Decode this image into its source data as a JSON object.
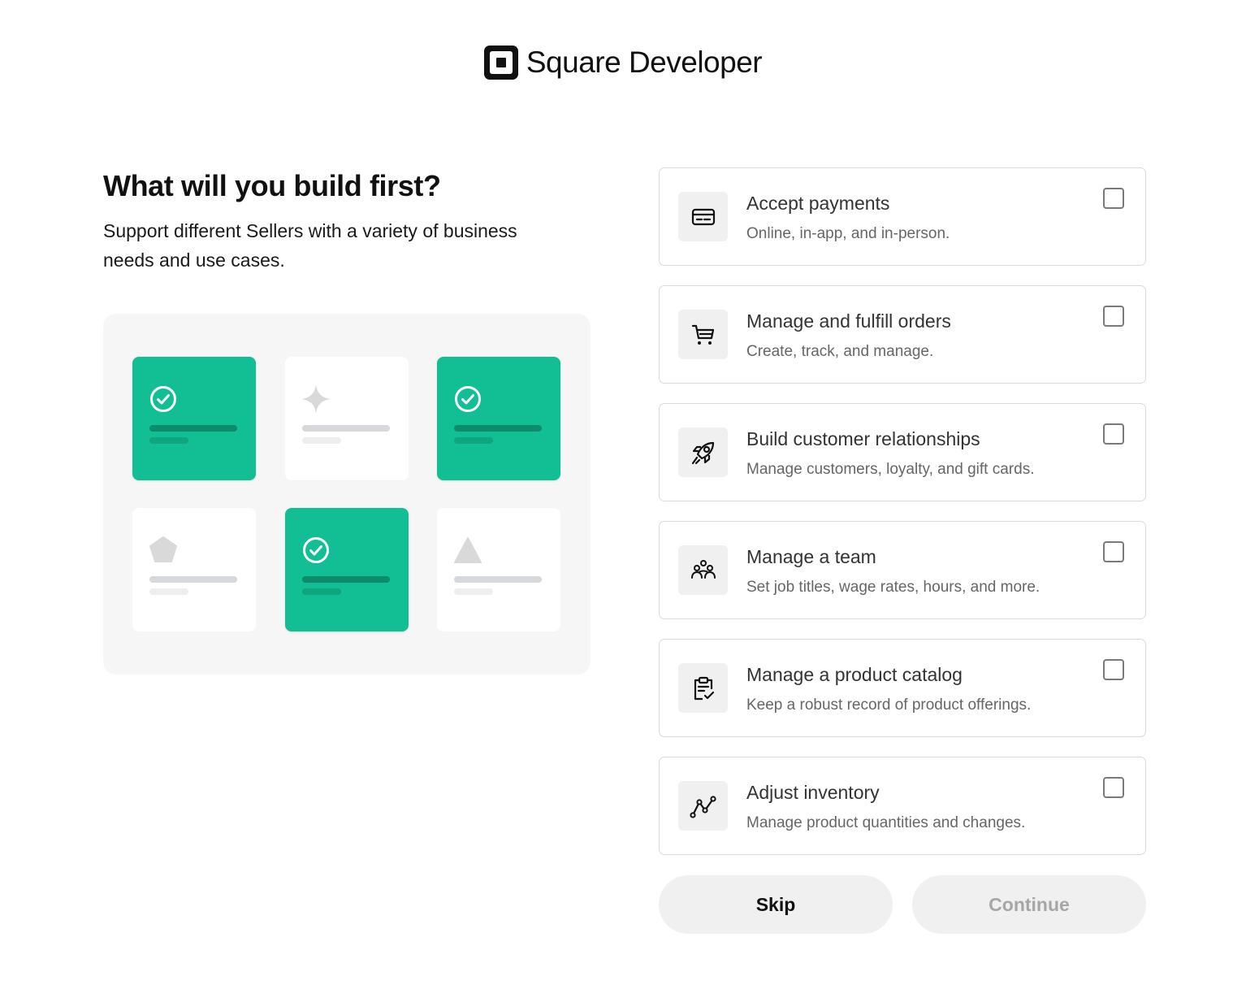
{
  "brand": {
    "name": "Square Developer",
    "logo_icon": "square-logo-icon"
  },
  "intro": {
    "title": "What will you build first?",
    "subtitle": "Support different Sellers with a variety of business needs and use cases."
  },
  "illustration": {
    "accent_color": "#12bf94",
    "tiles": [
      {
        "state": "selected",
        "icon": "check-circle-icon"
      },
      {
        "state": "unselected",
        "icon": "sparkle-icon"
      },
      {
        "state": "selected",
        "icon": "check-circle-icon"
      },
      {
        "state": "unselected",
        "icon": "pentagon-icon"
      },
      {
        "state": "selected",
        "icon": "check-circle-icon"
      },
      {
        "state": "unselected",
        "icon": "triangle-icon"
      }
    ]
  },
  "options": [
    {
      "title": "Accept payments",
      "description": "Online, in-app, and in-person.",
      "icon": "credit-card-icon",
      "checked": false
    },
    {
      "title": "Manage and fulfill orders",
      "description": "Create, track, and manage.",
      "icon": "shopping-cart-icon",
      "checked": false
    },
    {
      "title": "Build customer relationships",
      "description": "Manage customers, loyalty, and gift cards.",
      "icon": "rocket-icon",
      "checked": false
    },
    {
      "title": "Manage a team",
      "description": "Set job titles, wage rates, hours, and more.",
      "icon": "team-icon",
      "checked": false
    },
    {
      "title": "Manage a product catalog",
      "description": "Keep a robust record of product offerings.",
      "icon": "clipboard-check-icon",
      "checked": false
    },
    {
      "title": "Adjust inventory",
      "description": "Manage product quantities and changes.",
      "icon": "trend-line-icon",
      "checked": false
    }
  ],
  "actions": {
    "skip_label": "Skip",
    "continue_label": "Continue"
  }
}
